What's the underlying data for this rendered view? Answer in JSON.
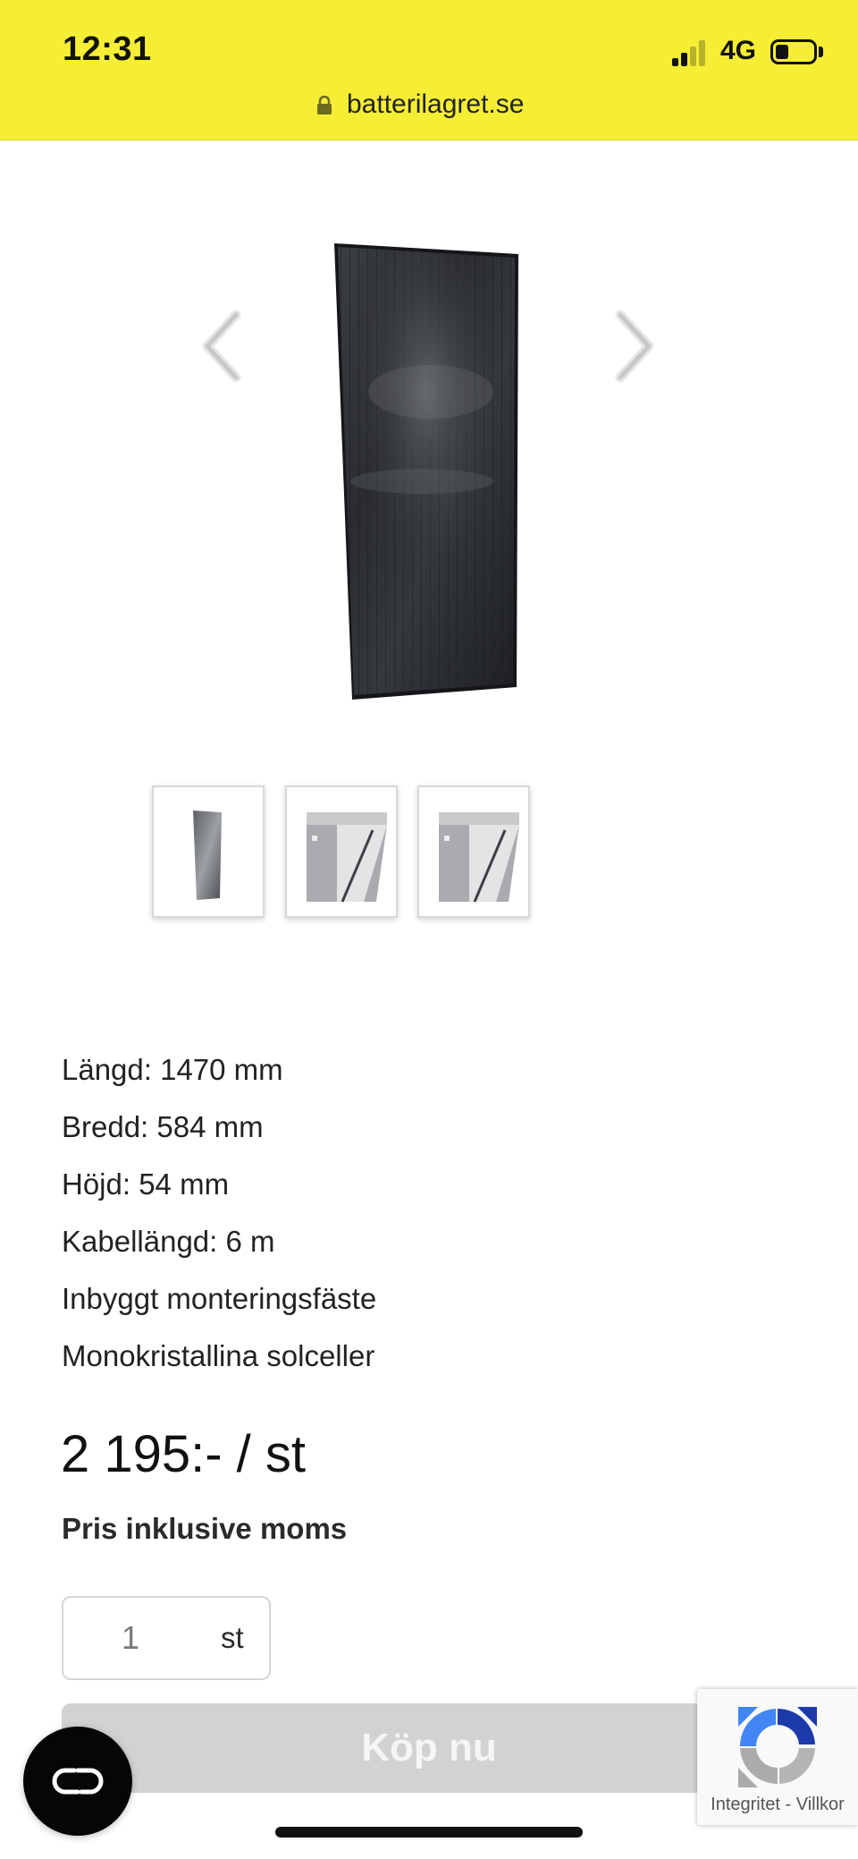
{
  "status_bar": {
    "time": "12:31",
    "network": "4G",
    "battery_level": 0.3
  },
  "address_bar": {
    "url": "batterilagret.se",
    "lock_icon": "lock-icon"
  },
  "gallery": {
    "main_image_label": "solar-panel",
    "prev_icon": "chevron-left-icon",
    "next_icon": "chevron-right-icon",
    "thumbnails": [
      "solar-panel-front",
      "solar-panel-edge",
      "solar-panel-edge-2"
    ]
  },
  "specs": [
    "Längd: 1470 mm",
    "Bredd: 584 mm",
    "Höjd: 54 mm",
    "Kabellängd: 6 m",
    "Inbyggt monteringsfäste",
    "Monokristallina solceller"
  ],
  "price": {
    "amount": "2 195:- / st",
    "note": "Pris inklusive moms"
  },
  "quantity": {
    "value": "1",
    "unit": "st"
  },
  "buy_button": {
    "label": "Köp nu"
  },
  "recaptcha": {
    "privacy": "Integritet",
    "separator": " - ",
    "terms": "Villkor"
  },
  "colors": {
    "top_bar": "#f6ee34",
    "buy_button_disabled": "#d2d2d2",
    "fab": "#060606"
  }
}
